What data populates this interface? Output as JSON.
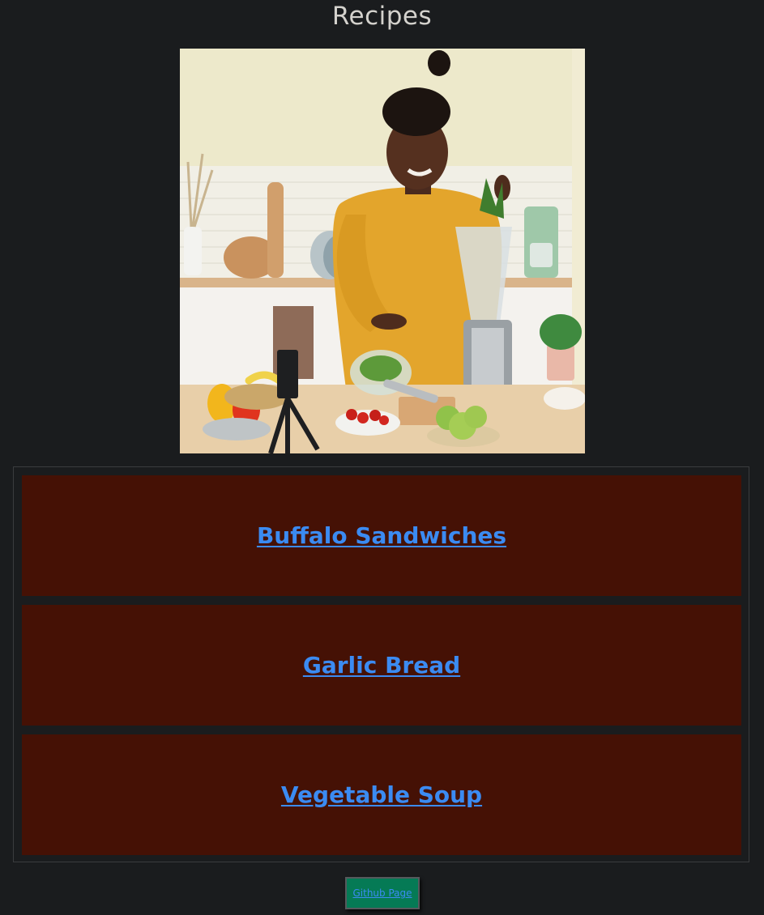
{
  "page": {
    "title": "Recipes"
  },
  "hero_image": {
    "description_icon": "kitchen-photo"
  },
  "recipes": [
    {
      "label": "Buffalo Sandwiches"
    },
    {
      "label": "Garlic Bread"
    },
    {
      "label": "Vegetable Soup"
    }
  ],
  "footer": {
    "github_label": "Github Page"
  },
  "colors": {
    "background": "#1a1c1e",
    "card_background": "#451105",
    "link": "#3b8bf2",
    "button_background": "#057a55",
    "title": "#d4d2cd"
  }
}
